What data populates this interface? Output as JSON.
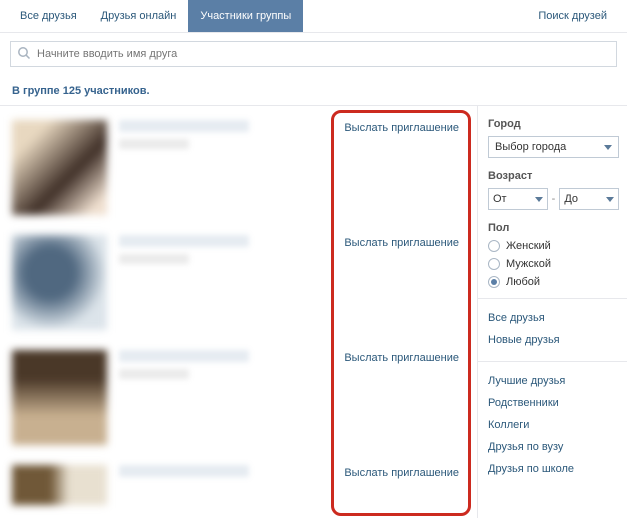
{
  "tabs": {
    "all": "Все друзья",
    "online": "Друзья онлайн",
    "group": "Участники группы",
    "search": "Поиск друзей"
  },
  "search": {
    "placeholder": "Начните вводить имя друга"
  },
  "countLine": "В группе 125 участников.",
  "inviteLabel": "Выслать приглашение",
  "filters": {
    "cityLabel": "Город",
    "citySelect": "Выбор города",
    "ageLabel": "Возраст",
    "ageFrom": "От",
    "ageTo": "До",
    "genderLabel": "Пол",
    "genderFemale": "Женский",
    "genderMale": "Мужской",
    "genderAny": "Любой"
  },
  "sideLinks": {
    "all": "Все друзья",
    "new": "Новые друзья",
    "best": "Лучшие друзья",
    "relatives": "Родственники",
    "colleagues": "Коллеги",
    "uni": "Друзья по вузу",
    "school": "Друзья по школе"
  }
}
